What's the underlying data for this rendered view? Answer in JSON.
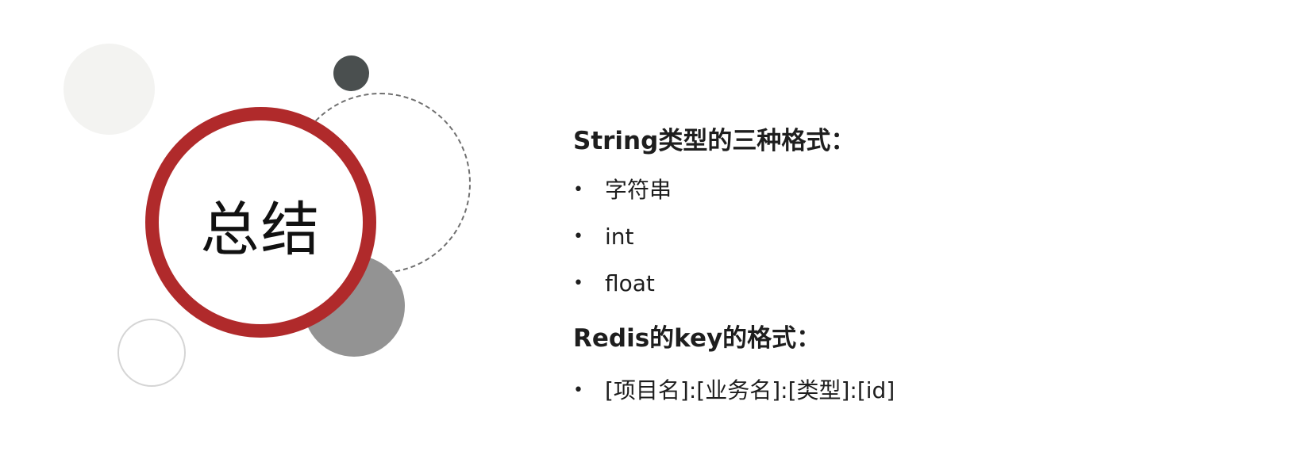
{
  "slide": {
    "title": "总结",
    "sections": [
      {
        "heading": "String类型的三种格式：",
        "items": [
          "字符串",
          "int",
          "float"
        ]
      },
      {
        "heading": "Redis的key的格式：",
        "items": [
          "[项目名]:[业务名]:[类型]:[id]"
        ]
      }
    ],
    "bullet": "•"
  },
  "colors": {
    "accent_red": "#b02a2b",
    "dark_dot": "#4a4f4f",
    "mid_gray": "#939393",
    "light_gray": "#f3f3f1",
    "dashed_ring": "#707070",
    "outline_ring": "#d5d5d5"
  }
}
